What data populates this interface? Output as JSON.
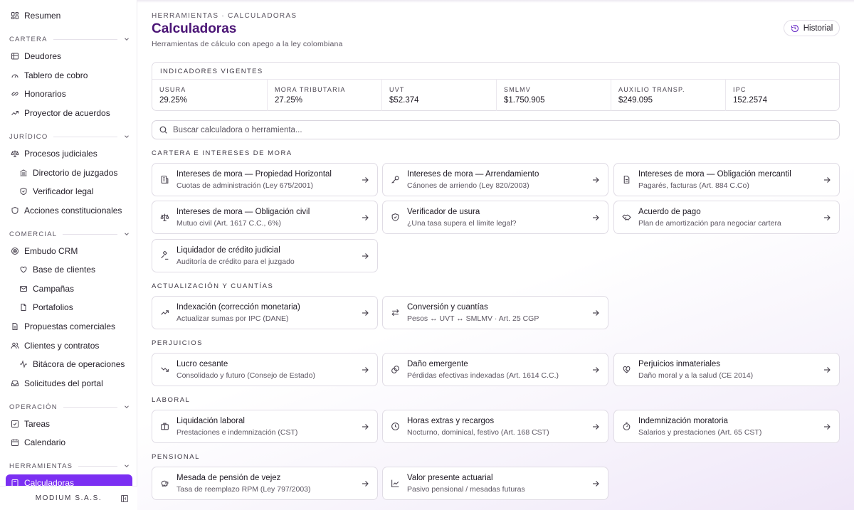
{
  "sidebar": {
    "top_item": "Resumen",
    "sections": [
      {
        "label": "CARTERA",
        "items": [
          {
            "label": "Deudores",
            "icon": "users-icon"
          },
          {
            "label": "Tablero de cobro",
            "icon": "gauge-icon"
          },
          {
            "label": "Honorarios",
            "icon": "handshake-icon"
          },
          {
            "label": "Proyector de acuerdos",
            "icon": "trending-up-icon"
          }
        ]
      },
      {
        "label": "JURÍDICO",
        "items": [
          {
            "label": "Procesos judiciales",
            "icon": "scale-icon"
          },
          {
            "label": "Directorio de juzgados",
            "icon": "landmark-icon"
          },
          {
            "label": "Verificador legal",
            "icon": "shield-check-icon"
          },
          {
            "label": "Acciones constitucionales",
            "icon": "shield-icon"
          }
        ]
      },
      {
        "label": "COMERCIAL",
        "items": [
          {
            "label": "Embudo CRM",
            "icon": "target-icon"
          },
          {
            "label": "Base de clientes",
            "icon": "heart-icon"
          },
          {
            "label": "Campañas",
            "icon": "mail-icon"
          },
          {
            "label": "Portafolios",
            "icon": "file-icon"
          },
          {
            "label": "Propuestas comerciales",
            "icon": "document-icon"
          },
          {
            "label": "Clientes y contratos",
            "icon": "user-group-icon"
          },
          {
            "label": "Bitácora de operaciones",
            "icon": "activity-icon"
          },
          {
            "label": "Solicitudes del portal",
            "icon": "inbox-icon"
          }
        ]
      },
      {
        "label": "OPERACIÓN",
        "items": [
          {
            "label": "Tareas",
            "icon": "checkbox-icon"
          },
          {
            "label": "Calendario",
            "icon": "calendar-icon"
          }
        ]
      },
      {
        "label": "HERRAMIENTAS",
        "items": [
          {
            "label": "Calculadoras",
            "icon": "calculator-icon"
          }
        ]
      }
    ],
    "footer": "MODIUM S.A.S."
  },
  "header": {
    "breadcrumb": "HERRAMIENTAS · CALCULADORAS",
    "title": "Calculadoras",
    "subtitle": "Herramientas de cálculo con apego a la ley colombiana",
    "history_button": "Historial"
  },
  "indicators": {
    "title": "INDICADORES VIGENTES",
    "items": [
      {
        "label": "USURA",
        "value": "29.25%"
      },
      {
        "label": "MORA TRIBUTARIA",
        "value": "27.25%"
      },
      {
        "label": "UVT",
        "value": "$52.374"
      },
      {
        "label": "SMLMV",
        "value": "$1.750.905"
      },
      {
        "label": "AUXILIO TRANSP.",
        "value": "$249.095"
      },
      {
        "label": "IPC",
        "value": "152.2574"
      }
    ]
  },
  "search": {
    "placeholder": "Buscar calculadora o herramienta..."
  },
  "sections": [
    {
      "title": "CARTERA E INTERESES DE MORA",
      "cards": [
        {
          "title": "Intereses de mora — Propiedad Horizontal",
          "subtitle": "Cuotas de administración (Ley 675/2001)",
          "icon": "building-icon"
        },
        {
          "title": "Intereses de mora — Arrendamiento",
          "subtitle": "Cánones de arriendo (Ley 820/2003)",
          "icon": "key-icon"
        },
        {
          "title": "Intereses de mora — Obligación mercantil",
          "subtitle": "Pagarés, facturas (Art. 884 C.Co)",
          "icon": "document-icon"
        },
        {
          "title": "Intereses de mora — Obligación civil",
          "subtitle": "Mutuo civil (Art. 1617 C.C., 6%)",
          "icon": "scale-icon"
        },
        {
          "title": "Verificador de usura",
          "subtitle": "¿Una tasa supera el límite legal?",
          "icon": "shield-check-icon"
        },
        {
          "title": "Acuerdo de pago",
          "subtitle": "Plan de amortización para negociar cartera",
          "icon": "handshake-icon"
        },
        {
          "title": "Liquidador de crédito judicial",
          "subtitle": "Auditoría de crédito para el juzgado",
          "icon": "gavel-icon"
        }
      ]
    },
    {
      "title": "ACTUALIZACIÓN Y CUANTÍAS",
      "cards": [
        {
          "title": "Indexación (corrección monetaria)",
          "subtitle": "Actualizar sumas por IPC (DANE)",
          "icon": "trending-up-icon"
        },
        {
          "title": "Conversión y cuantías",
          "subtitle": "Pesos ↔ UVT ↔ SMLMV · Art. 25 CGP",
          "icon": "swap-icon"
        }
      ]
    },
    {
      "title": "PERJUICIOS",
      "cards": [
        {
          "title": "Lucro cesante",
          "subtitle": "Consolidado y futuro (Consejo de Estado)",
          "icon": "trending-down-icon"
        },
        {
          "title": "Daño emergente",
          "subtitle": "Pérdidas efectivas indexadas (Art. 1614 C.C.)",
          "icon": "coins-icon"
        },
        {
          "title": "Perjuicios inmateriales",
          "subtitle": "Daño moral y a la salud (CE 2014)",
          "icon": "heart-crack-icon"
        }
      ]
    },
    {
      "title": "LABORAL",
      "cards": [
        {
          "title": "Liquidación laboral",
          "subtitle": "Prestaciones e indemnización (CST)",
          "icon": "briefcase-icon"
        },
        {
          "title": "Horas extras y recargos",
          "subtitle": "Nocturno, dominical, festivo (Art. 168 CST)",
          "icon": "clock-icon"
        },
        {
          "title": "Indemnización moratoria",
          "subtitle": "Salarios y prestaciones (Art. 65 CST)",
          "icon": "timer-icon"
        }
      ]
    },
    {
      "title": "PENSIONAL",
      "cards": [
        {
          "title": "Mesada de pensión de vejez",
          "subtitle": "Tasa de reemplazo RPM (Ley 797/2003)",
          "icon": "piggy-bank-icon"
        },
        {
          "title": "Valor presente actuarial",
          "subtitle": "Pasivo pensional / mesadas futuras",
          "icon": "line-chart-icon"
        }
      ]
    }
  ]
}
